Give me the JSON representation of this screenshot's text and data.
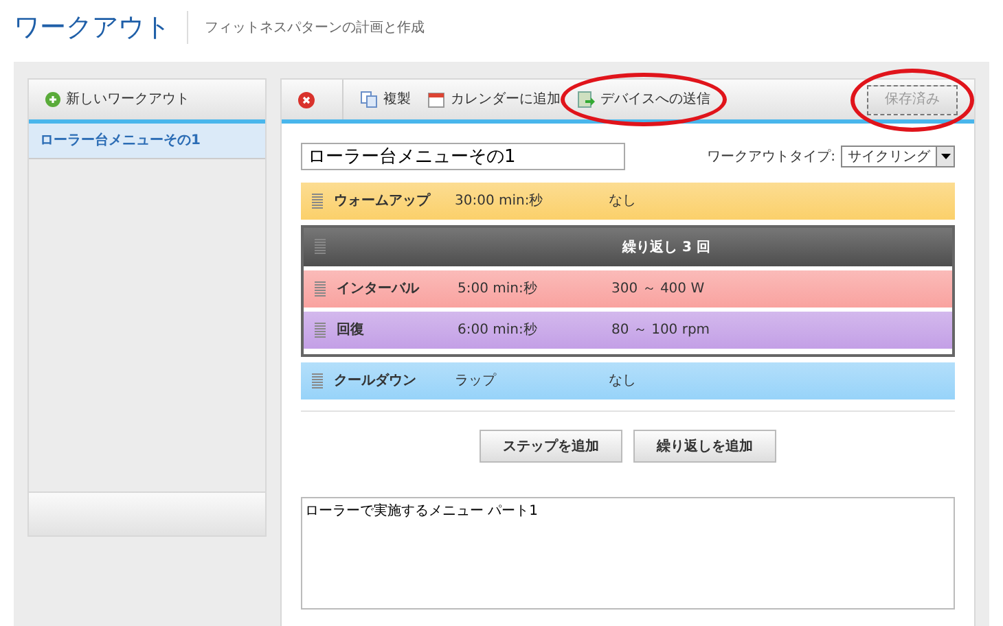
{
  "header": {
    "title": "ワークアウト",
    "subtitle": "フィットネスパターンの計画と作成"
  },
  "sidebar": {
    "new_button": "新しいワークアウト",
    "items": [
      {
        "label": "ローラー台メニューその1",
        "selected": true
      }
    ]
  },
  "toolbar": {
    "items": [
      {
        "kind": "delete",
        "circled": false
      },
      {
        "kind": "copy",
        "label": "複製",
        "circled": false
      },
      {
        "kind": "calendar",
        "label": "カレンダーに追加",
        "circled": false
      },
      {
        "kind": "send",
        "label": "デバイスへの送信",
        "circled": true
      }
    ],
    "save_button": {
      "label": "保存済み",
      "disabled": true,
      "circled": true
    }
  },
  "workout": {
    "name": "ローラー台メニューその1",
    "type_label": "ワークアウトタイプ:",
    "type_value": "サイクリング",
    "steps": [
      {
        "kind": "step",
        "name": "ウォームアップ",
        "duration": "30:00 min:秒",
        "target": "なし",
        "color": "#fbd06a"
      },
      {
        "kind": "repeat",
        "label": "繰り返し 3 回",
        "steps": [
          {
            "name": "インターバル",
            "duration": "5:00 min:秒",
            "target": "300 ～ 400 W",
            "color": "#f9a29f"
          },
          {
            "name": "回復",
            "duration": "6:00 min:秒",
            "target": "80 ～ 100 rpm",
            "color": "#c39fe6"
          }
        ]
      },
      {
        "kind": "step",
        "name": "クールダウン",
        "duration": "ラップ",
        "target": "なし",
        "color": "#97d3f9"
      }
    ],
    "buttons": [
      "ステップを追加",
      "繰り返しを追加"
    ],
    "notes": "ローラーで実施するメニュー パート1"
  }
}
